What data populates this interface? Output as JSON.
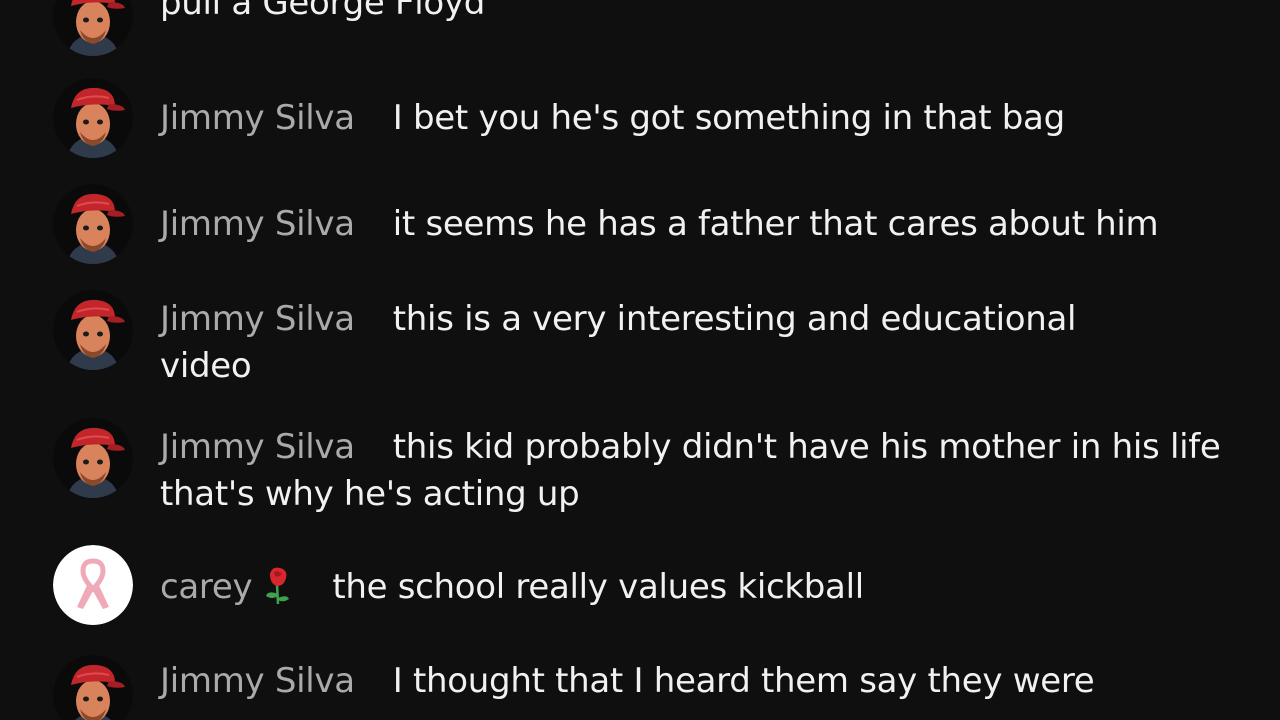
{
  "chat": {
    "messages": [
      {
        "author": "",
        "text": "pull a George Floyd",
        "avatar": "red-cap-avatar-icon"
      },
      {
        "author": "Jimmy Silva",
        "text": "I bet you he's got something in that bag",
        "avatar": "red-cap-avatar-icon"
      },
      {
        "author": "Jimmy Silva",
        "text": "it seems he has a father that cares about him",
        "avatar": "red-cap-avatar-icon"
      },
      {
        "author": "Jimmy Silva",
        "text": "this is a very interesting and educational video",
        "avatar": "red-cap-avatar-icon"
      },
      {
        "author": "Jimmy Silva",
        "text": "this kid probably didn't have his mother in his life that's why he's acting up",
        "avatar": "red-cap-avatar-icon"
      },
      {
        "author": "carey",
        "text": "the school really values kickball",
        "avatar": "pink-ribbon-avatar-icon",
        "badge": "rose-emoji-icon"
      },
      {
        "author": "Jimmy Silva",
        "text": "I thought that I heard them say they were",
        "avatar": "red-cap-avatar-icon"
      }
    ]
  },
  "colors": {
    "background": "#0f0f0f",
    "author": "#aaaaaa",
    "text": "#f1f1f1"
  }
}
